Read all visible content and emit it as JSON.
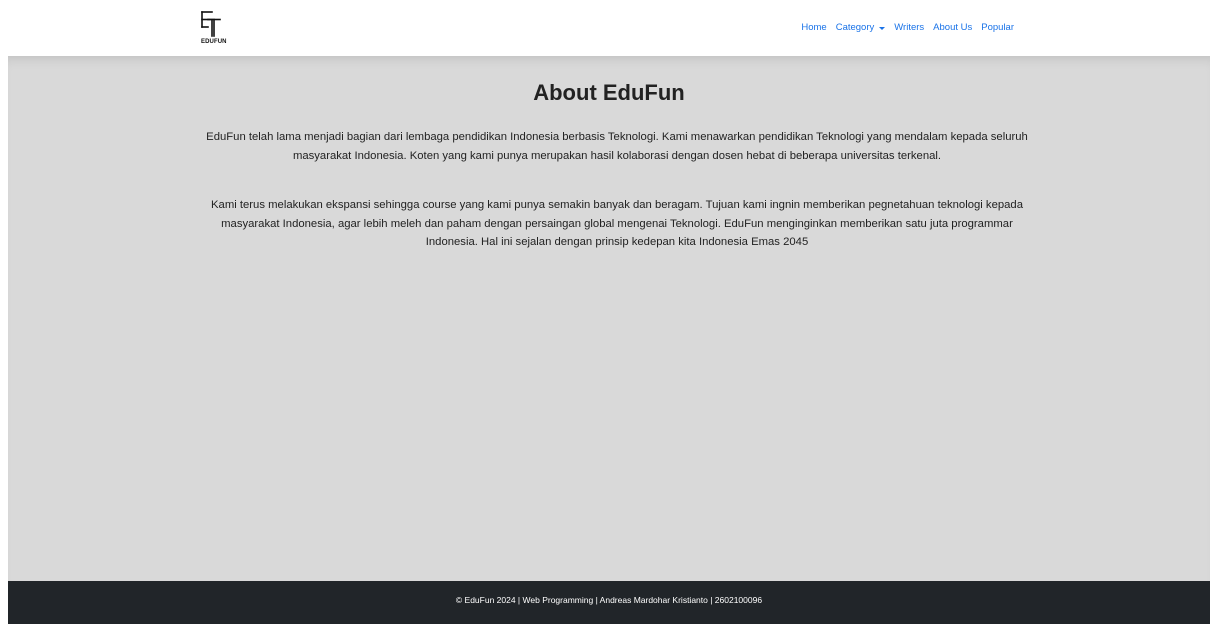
{
  "brand": {
    "logo_text": "EDUFUN"
  },
  "nav": {
    "items": [
      {
        "label": "Home"
      },
      {
        "label": "Category"
      },
      {
        "label": "Writers"
      },
      {
        "label": "About Us"
      },
      {
        "label": "Popular"
      }
    ]
  },
  "main": {
    "title": "About EduFun",
    "paragraphs": [
      "EduFun telah lama menjadi bagian dari lembaga pendidikan Indonesia berbasis Teknologi. Kami menawarkan pendidikan Teknologi yang mendalam kepada seluruh masyarakat Indonesia. Koten yang kami punya merupakan hasil kolaborasi dengan dosen hebat di beberapa universitas terkenal.",
      "Kami terus melakukan ekspansi sehingga course yang kami punya semakin banyak dan beragam. Tujuan kami ingnin memberikan pegnetahuan teknologi kepada masyarakat Indonesia, agar lebih meleh dan paham dengan persaingan global mengenai Teknologi. EduFun menginginkan memberikan satu juta programmar Indonesia. Hal ini sejalan dengan prinsip kedepan kita Indonesia Emas 2045"
    ]
  },
  "footer": {
    "text": "© EduFun 2024 | Web Programming | Andreas Mardohar Kristianto | 2602100096"
  },
  "colors": {
    "nav_link": "#1a73e8",
    "main_bg": "#d9d9d9",
    "footer_bg": "#212529",
    "text": "#222222"
  },
  "icons": {
    "logo": "edufun-logo-icon",
    "dropdown": "caret-down-icon"
  }
}
